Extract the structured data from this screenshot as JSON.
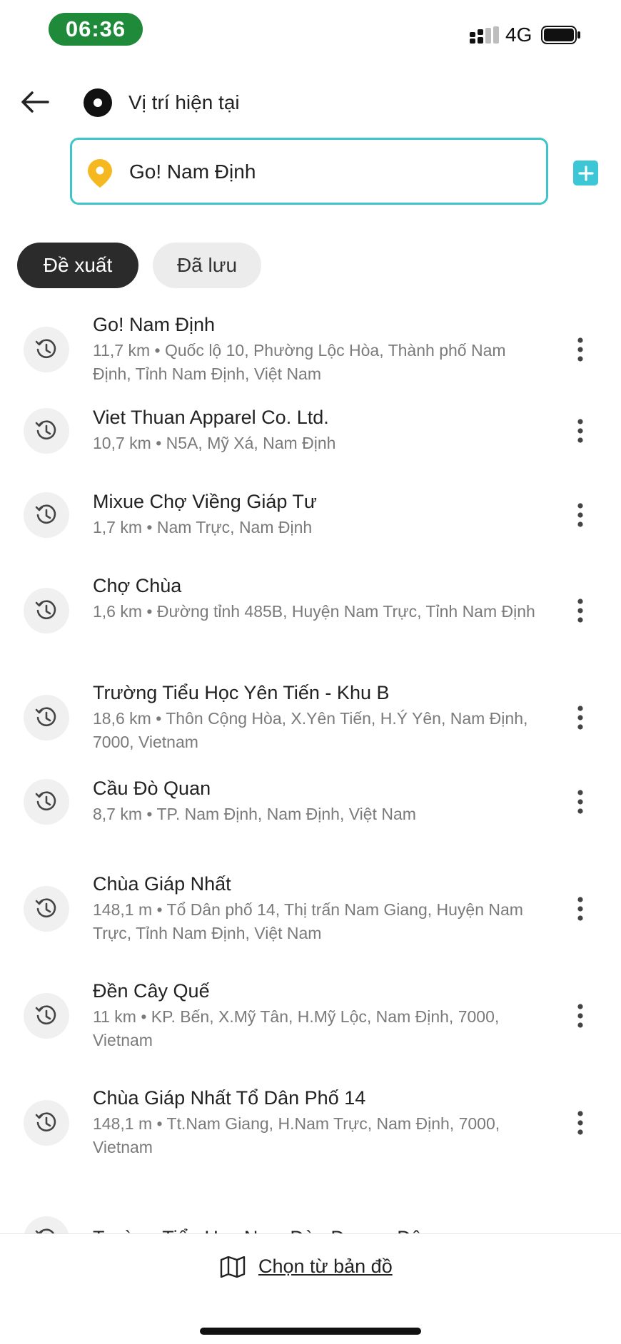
{
  "status_bar": {
    "time": "06:36",
    "network": "4G",
    "time_pill_color": "#1f8a3a"
  },
  "route": {
    "origin_label": "Vị trí hiện tại",
    "destination_value": "Go! Nam Định",
    "accent_color": "#3cc6cc",
    "pin_color": "#f5b820"
  },
  "tabs": [
    {
      "label": "Đề xuất",
      "active": true
    },
    {
      "label": "Đã lưu",
      "active": false
    }
  ],
  "places": [
    {
      "title": "Go! Nam Định",
      "distance": "11,7 km",
      "address": "Quốc lộ 10, Phường Lộc Hòa, Thành phố Nam Định, Tỉnh Nam Định, Việt Nam"
    },
    {
      "title": "Viet Thuan Apparel Co. Ltd.",
      "distance": "10,7 km",
      "address": "N5A, Mỹ Xá, Nam Định"
    },
    {
      "title": "Mixue Chợ Viềng Giáp Tư",
      "distance": "1,7 km",
      "address": "Nam Trực, Nam Định"
    },
    {
      "title": "Chợ Chùa",
      "distance": "1,6 km",
      "address": "Đường tỉnh 485B, Huyện Nam Trực, Tỉnh Nam Định"
    },
    {
      "title": "Trường Tiểu Học Yên Tiến - Khu B",
      "distance": "18,6 km",
      "address": "Thôn Cộng Hòa, X.Yên Tiến, H.Ý Yên, Nam Định, 7000, Vietnam"
    },
    {
      "title": "Cầu Đò Quan",
      "distance": "8,7 km",
      "address": "TP. Nam Định, Nam Định, Việt Nam"
    },
    {
      "title": "Chùa Giáp Nhất",
      "distance": "148,1 m",
      "address": "Tổ Dân phố 14, Thị trấn Nam Giang, Huyện Nam Trực, Tỉnh Nam Định, Việt Nam"
    },
    {
      "title": "Đền Cây Quế",
      "distance": "11 km",
      "address": "KP. Bến, X.Mỹ Tân, H.Mỹ Lộc, Nam Định, 7000, Vietnam"
    },
    {
      "title": "Chùa Giáp Nhất Tổ Dân Phố 14",
      "distance": "148,1 m",
      "address": "Tt.Nam Giang, H.Nam Trực, Nam Định, 7000, Vietnam"
    },
    {
      "title": "Trường Tiểu Học Nam Đào Dương Đô",
      "distance": "",
      "address": ""
    }
  ],
  "bottom": {
    "map_link_label": "Chọn từ bản đồ"
  },
  "icons": [
    "back-arrow-icon",
    "origin-dot-icon",
    "location-pin-icon",
    "plus-icon",
    "history-icon",
    "more-vertical-icon",
    "map-icon"
  ]
}
